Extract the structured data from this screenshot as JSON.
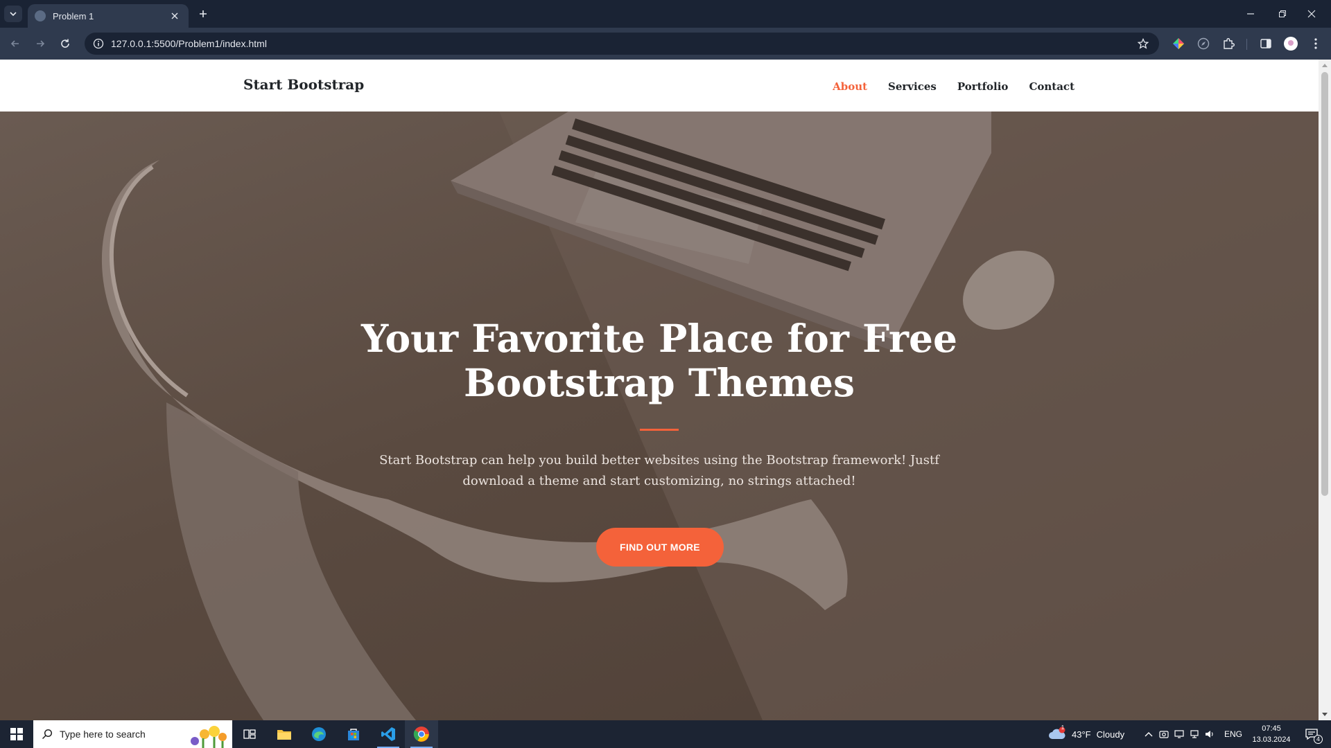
{
  "browser": {
    "tab_title": "Problem 1",
    "url": "127.0.0.1:5500/Problem1/index.html"
  },
  "site": {
    "brand": "Start Bootstrap",
    "nav": [
      {
        "label": "About",
        "active": true
      },
      {
        "label": "Services",
        "active": false
      },
      {
        "label": "Portfolio",
        "active": false
      },
      {
        "label": "Contact",
        "active": false
      }
    ],
    "hero": {
      "title": "Your Favorite Place for Free Bootstrap Themes",
      "text": "Start Bootstrap can help you build better websites using the Bootstrap framework! Justf download a theme and start customizing, no strings attached!",
      "button": "FIND OUT MORE"
    },
    "colors": {
      "accent": "#f4623a",
      "hero_overlay": "#5a4a40"
    }
  },
  "taskbar": {
    "search_placeholder": "Type here to search",
    "weather": {
      "temp": "43°F",
      "condition": "Cloudy",
      "alert_count": "1"
    },
    "language": "ENG",
    "time": "07:45",
    "date": "13.03.2024",
    "notification_count": "4"
  }
}
